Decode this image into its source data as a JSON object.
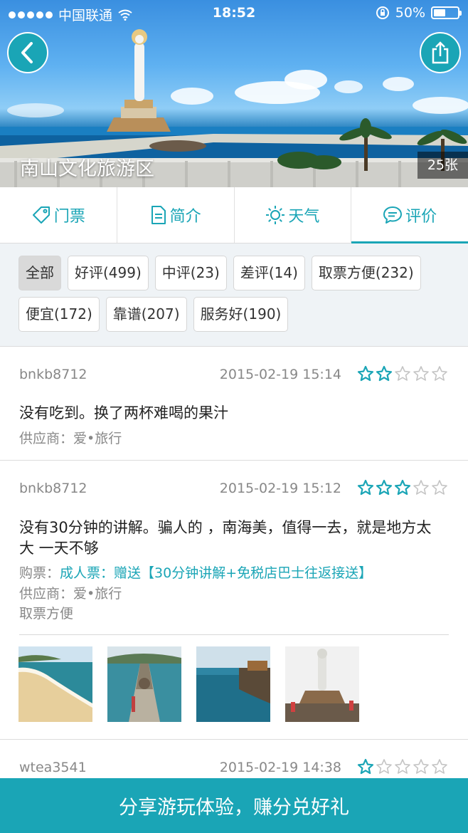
{
  "status_bar": {
    "carrier": "中国联通",
    "time": "18:52",
    "battery": "50%",
    "battery_level": 0.5
  },
  "hero": {
    "title": "南山文化旅游区",
    "photo_count": "25张"
  },
  "tabs": [
    {
      "label": "门票",
      "icon": "tag-icon"
    },
    {
      "label": "简介",
      "icon": "document-icon"
    },
    {
      "label": "天气",
      "icon": "sun-icon"
    },
    {
      "label": "评价",
      "icon": "chat-bubble-icon",
      "active": true
    }
  ],
  "filters": [
    {
      "label": "全部",
      "active": true
    },
    {
      "label": "好评(499)"
    },
    {
      "label": "中评(23)"
    },
    {
      "label": "差评(14)"
    },
    {
      "label": "取票方便(232)"
    },
    {
      "label": "便宜(172)"
    },
    {
      "label": "靠谱(207)"
    },
    {
      "label": "服务好(190)"
    }
  ],
  "reviews": [
    {
      "user": "bnkb8712",
      "date": "2015-02-19 15:14",
      "rating": 2,
      "text": "没有吃到。换了两杯难喝的果汁",
      "supplier": "供应商：爱•旅行"
    },
    {
      "user": "bnkb8712",
      "date": "2015-02-19 15:12",
      "rating": 3,
      "text": "没有30分钟的讲解。骗人的 ，南海美，值得一去，就是地方太大 一天不够",
      "ticket_label": "购票：",
      "ticket_value": "成人票：赠送【30分钟讲解+免税店巴士往返接送】",
      "supplier": "供应商：爱•旅行",
      "tag": "取票方便",
      "photos": [
        "beach-photo",
        "pier-photo",
        "sea-photo",
        "statue-photo"
      ]
    },
    {
      "user": "wtea3541",
      "date": "2015-02-19 14:38",
      "rating": 1
    }
  ],
  "bottom_bar": {
    "label": "分享游玩体验，赚分兑好礼"
  },
  "colors": {
    "accent": "#1aa5b6",
    "filter_bg": "#eff3f6"
  }
}
